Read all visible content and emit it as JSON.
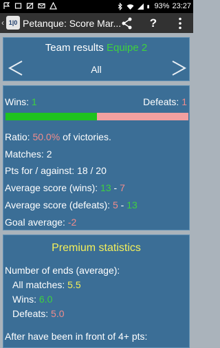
{
  "status": {
    "battery": "93%",
    "time": "23:27"
  },
  "appbar": {
    "title": "Petanque: Score Mar..."
  },
  "team": {
    "title": "Team results",
    "team_name": "Equipe 2",
    "filter": "All"
  },
  "stats": {
    "wins_label": "Wins:",
    "wins": "1",
    "defeats_label": "Defeats:",
    "defeats": "1",
    "win_fraction": 0.5,
    "ratio_label": "Ratio:",
    "ratio": "50.0%",
    "ratio_suffix": "of victories.",
    "matches_label": "Matches:",
    "matches": "2",
    "pts_label": "Pts for / against:",
    "pts": "18 / 20",
    "avg_wins_label": "Average score (wins):",
    "avg_wins_for": "13",
    "avg_wins_sep": "-",
    "avg_wins_against": "7",
    "avg_defeats_label": "Average score (defeats):",
    "avg_defeats_for": "5",
    "avg_defeats_sep": "-",
    "avg_defeats_against": "13",
    "goal_avg_label": "Goal average:",
    "goal_avg": "-2"
  },
  "premium": {
    "title": "Premium statistics",
    "ends_label": "Number of ends (average):",
    "all_label": "All matches:",
    "all_value": "5.5",
    "wins_label": "Wins:",
    "wins_value": "6.0",
    "defeats_label": "Defeats:",
    "defeats_value": "5.0",
    "after_label": "After have been in front of 4+ pts:"
  },
  "colors": {
    "panel": "#3b6e96",
    "win": "#1fc21f",
    "loss": "#f2a0a0",
    "accent_green": "#3ed13e",
    "accent_yellow": "#f5f05a"
  },
  "icons": [
    "share-icon",
    "help-icon",
    "overflow-menu-icon",
    "prev-arrow-icon",
    "next-arrow-icon"
  ]
}
